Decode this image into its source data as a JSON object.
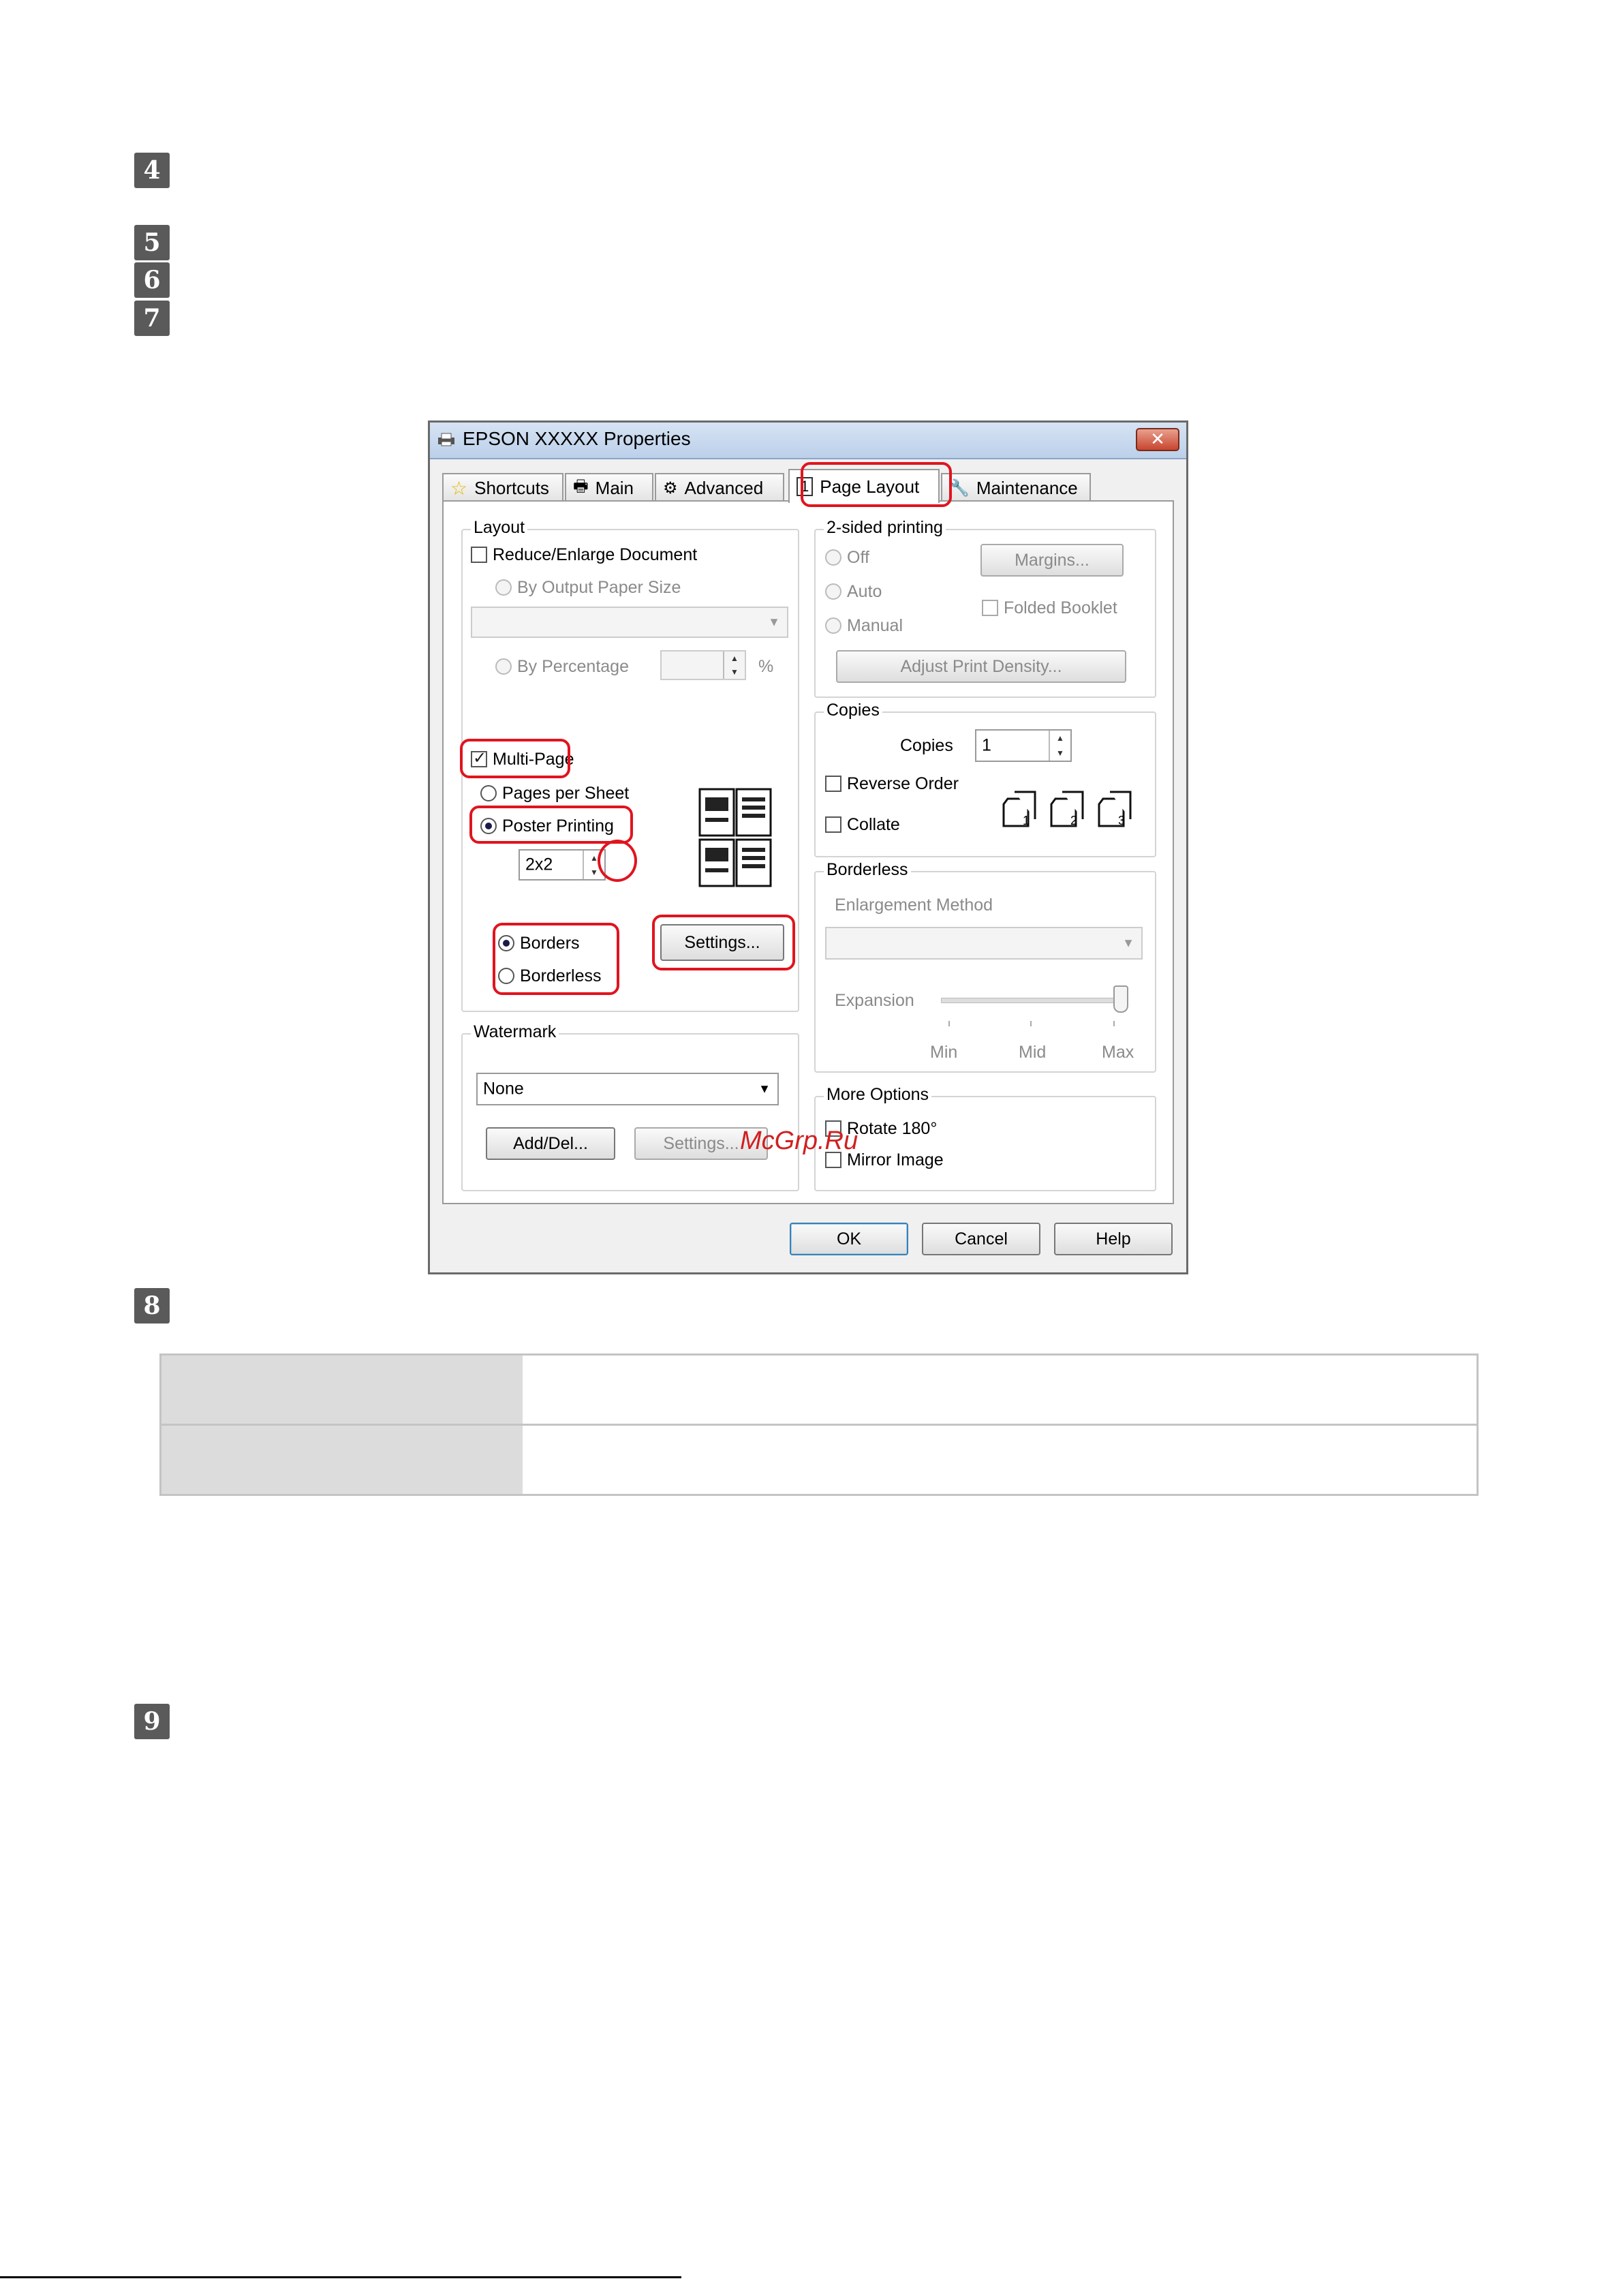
{
  "steps": [
    "4",
    "5",
    "6",
    "7",
    "8",
    "9"
  ],
  "dialog": {
    "title": "EPSON XXXXX Properties",
    "tabs": [
      {
        "label": "Shortcuts",
        "icon": "star-icon"
      },
      {
        "label": "Main",
        "icon": "printer-icon"
      },
      {
        "label": "Advanced",
        "icon": "gears-icon"
      },
      {
        "label": "Page Layout",
        "icon": "page-icon",
        "active": true
      },
      {
        "label": "Maintenance",
        "icon": "wrench-icon"
      }
    ],
    "layout": {
      "label": "Layout",
      "reduce_enlarge": "Reduce/Enlarge Document",
      "by_output_paper_size": "By Output Paper Size",
      "by_percentage": "By Percentage",
      "percent_sign": "%",
      "multi_page": "Multi-Page",
      "pages_per_sheet": "Pages per Sheet",
      "poster_printing": "Poster Printing",
      "poster_value": "2x2",
      "borders": "Borders",
      "borderless": "Borderless",
      "settings": "Settings..."
    },
    "two_sided": {
      "label": "2-sided printing",
      "off": "Off",
      "auto": "Auto",
      "manual": "Manual",
      "margins": "Margins...",
      "folded_booklet": "Folded Booklet",
      "adjust_density": "Adjust Print Density..."
    },
    "copies": {
      "label": "Copies",
      "copies_label": "Copies",
      "copies_value": "1",
      "reverse_order": "Reverse Order",
      "collate": "Collate"
    },
    "borderless": {
      "label": "Borderless",
      "enlargement_method": "Enlargement Method",
      "expansion": "Expansion",
      "min": "Min",
      "mid": "Mid",
      "max": "Max",
      "slider_position": 1.0
    },
    "watermark": {
      "label": "Watermark",
      "value": "None",
      "add_del": "Add/Del...",
      "settings": "Settings..."
    },
    "more_options": {
      "label": "More Options",
      "rotate": "Rotate 180°",
      "mirror": "Mirror Image"
    },
    "buttons": {
      "ok": "OK",
      "cancel": "Cancel",
      "help": "Help"
    }
  },
  "watermark_text": "McGrp.Ru",
  "colors": {
    "highlight": "#e0141e",
    "step_badge": "#5a5a5a"
  }
}
